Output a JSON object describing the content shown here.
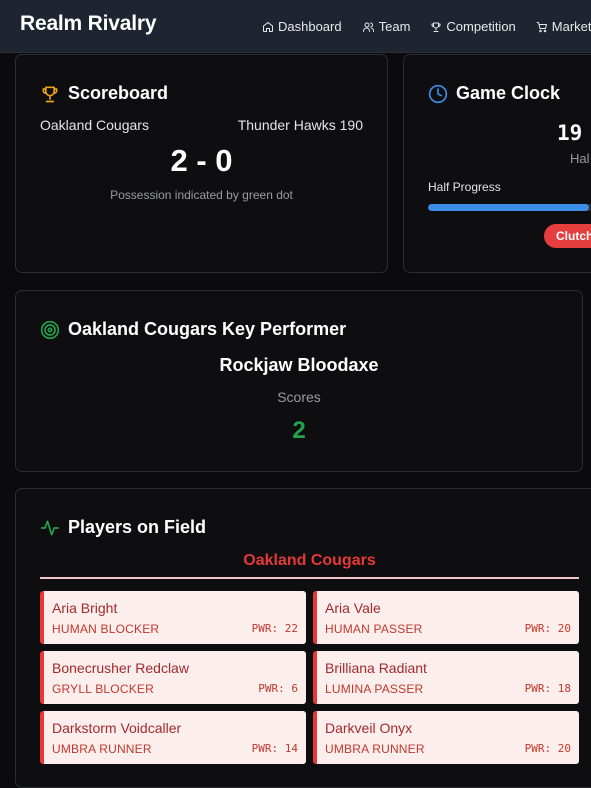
{
  "app": {
    "title": "Realm Rivalry"
  },
  "nav": {
    "items": [
      {
        "label": "Dashboard",
        "icon": "home-icon"
      },
      {
        "label": "Team",
        "icon": "users-icon"
      },
      {
        "label": "Competition",
        "icon": "trophy-icon"
      },
      {
        "label": "Market",
        "icon": "cart-icon"
      }
    ]
  },
  "scoreboard": {
    "title": "Scoreboard",
    "home_team": "Oakland Cougars",
    "away_team": "Thunder Hawks 190",
    "score": "2 - 0",
    "note": "Possession indicated by green dot"
  },
  "clock": {
    "title": "Game Clock",
    "time": "19 :",
    "half": "Hal",
    "progress_label": "Half Progress",
    "progress_fraction": 0.62,
    "badge": "Clutch"
  },
  "performer": {
    "title": "Oakland Cougars Key Performer",
    "name": "Rockjaw Bloodaxe",
    "stat_label": "Scores",
    "stat_value": "2"
  },
  "players": {
    "title": "Players on Field",
    "team": "Oakland Cougars",
    "list": [
      {
        "name": "Aria Bright",
        "role": "HUMAN BLOCKER",
        "pwr": "PWR: 22"
      },
      {
        "name": "Aria Vale",
        "role": "HUMAN PASSER",
        "pwr": "PWR: 20"
      },
      {
        "name": "Bonecrusher Redclaw",
        "role": "GRYLL BLOCKER",
        "pwr": "PWR: 6"
      },
      {
        "name": "Brilliana Radiant",
        "role": "LUMINA PASSER",
        "pwr": "PWR: 18"
      },
      {
        "name": "Darkstorm Voidcaller",
        "role": "UMBRA RUNNER",
        "pwr": "PWR: 14"
      },
      {
        "name": "Darkveil Onyx",
        "role": "UMBRA RUNNER",
        "pwr": "PWR: 20"
      }
    ]
  },
  "colors": {
    "accent_red": "#e53935",
    "progress_blue": "#3b8de6",
    "success_green": "#22a34a",
    "trophy_gold": "#e8a317"
  }
}
